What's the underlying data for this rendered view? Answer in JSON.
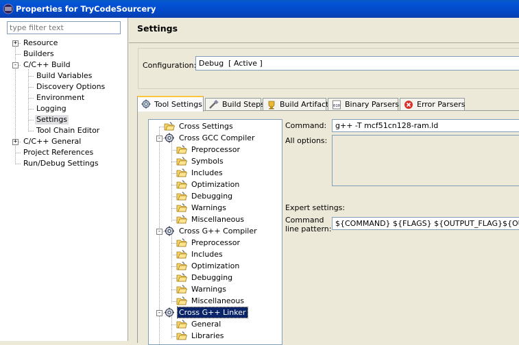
{
  "window": {
    "title": "Properties for TryCodeSourcery"
  },
  "left": {
    "filter_placeholder": "type filter text",
    "tree": [
      {
        "label": "Resource",
        "expander": "+"
      },
      {
        "label": "Builders"
      },
      {
        "label": "C/C++ Build",
        "expander": "-"
      },
      {
        "label": "Build Variables"
      },
      {
        "label": "Discovery Options"
      },
      {
        "label": "Environment"
      },
      {
        "label": "Logging"
      },
      {
        "label": "Settings"
      },
      {
        "label": "Tool Chain Editor"
      },
      {
        "label": "C/C++ General",
        "expander": "+"
      },
      {
        "label": "Project References"
      },
      {
        "label": "Run/Debug Settings"
      }
    ]
  },
  "main": {
    "title": "Settings",
    "configuration_label": "Configuration:",
    "configuration_value": "Debug  [ Active ]",
    "tabs": [
      {
        "label": "Tool Settings",
        "icon": "gear-icon"
      },
      {
        "label": "Build Steps",
        "icon": "build-steps-icon"
      },
      {
        "label": "Build Artifact",
        "icon": "artifact-icon"
      },
      {
        "label": "Binary Parsers",
        "icon": "binary-icon"
      },
      {
        "label": "Error Parsers",
        "icon": "error-icon"
      }
    ],
    "tool_tree": [
      {
        "label": "Cross Settings"
      },
      {
        "label": "Cross GCC Compiler",
        "expander": "-"
      },
      {
        "label": "Preprocessor"
      },
      {
        "label": "Symbols"
      },
      {
        "label": "Includes"
      },
      {
        "label": "Optimization"
      },
      {
        "label": "Debugging"
      },
      {
        "label": "Warnings"
      },
      {
        "label": "Miscellaneous"
      },
      {
        "label": "Cross G++ Compiler",
        "expander": "-"
      },
      {
        "label": "Preprocessor"
      },
      {
        "label": "Includes"
      },
      {
        "label": "Optimization"
      },
      {
        "label": "Debugging"
      },
      {
        "label": "Warnings"
      },
      {
        "label": "Miscellaneous"
      },
      {
        "label": "Cross G++ Linker",
        "expander": "-"
      },
      {
        "label": "General"
      },
      {
        "label": "Libraries"
      }
    ],
    "command_label": "Command:",
    "command_value": "g++ -T mcf51cn128-ram.ld",
    "all_options_label": "All options:",
    "expert_settings_label": "Expert settings:",
    "command_line_pattern_label_1": "Command",
    "command_line_pattern_label_2": "line pattern:",
    "command_line_pattern_value": "${COMMAND} ${FLAGS} ${OUTPUT_FLAG}${OUTPUT_PREFIX}${OUTPUT} ${INPUTS}"
  },
  "colors": {
    "titlebar": "#0353d6",
    "selection": "#0a246a",
    "tab_highlight": "#ffc83c"
  }
}
